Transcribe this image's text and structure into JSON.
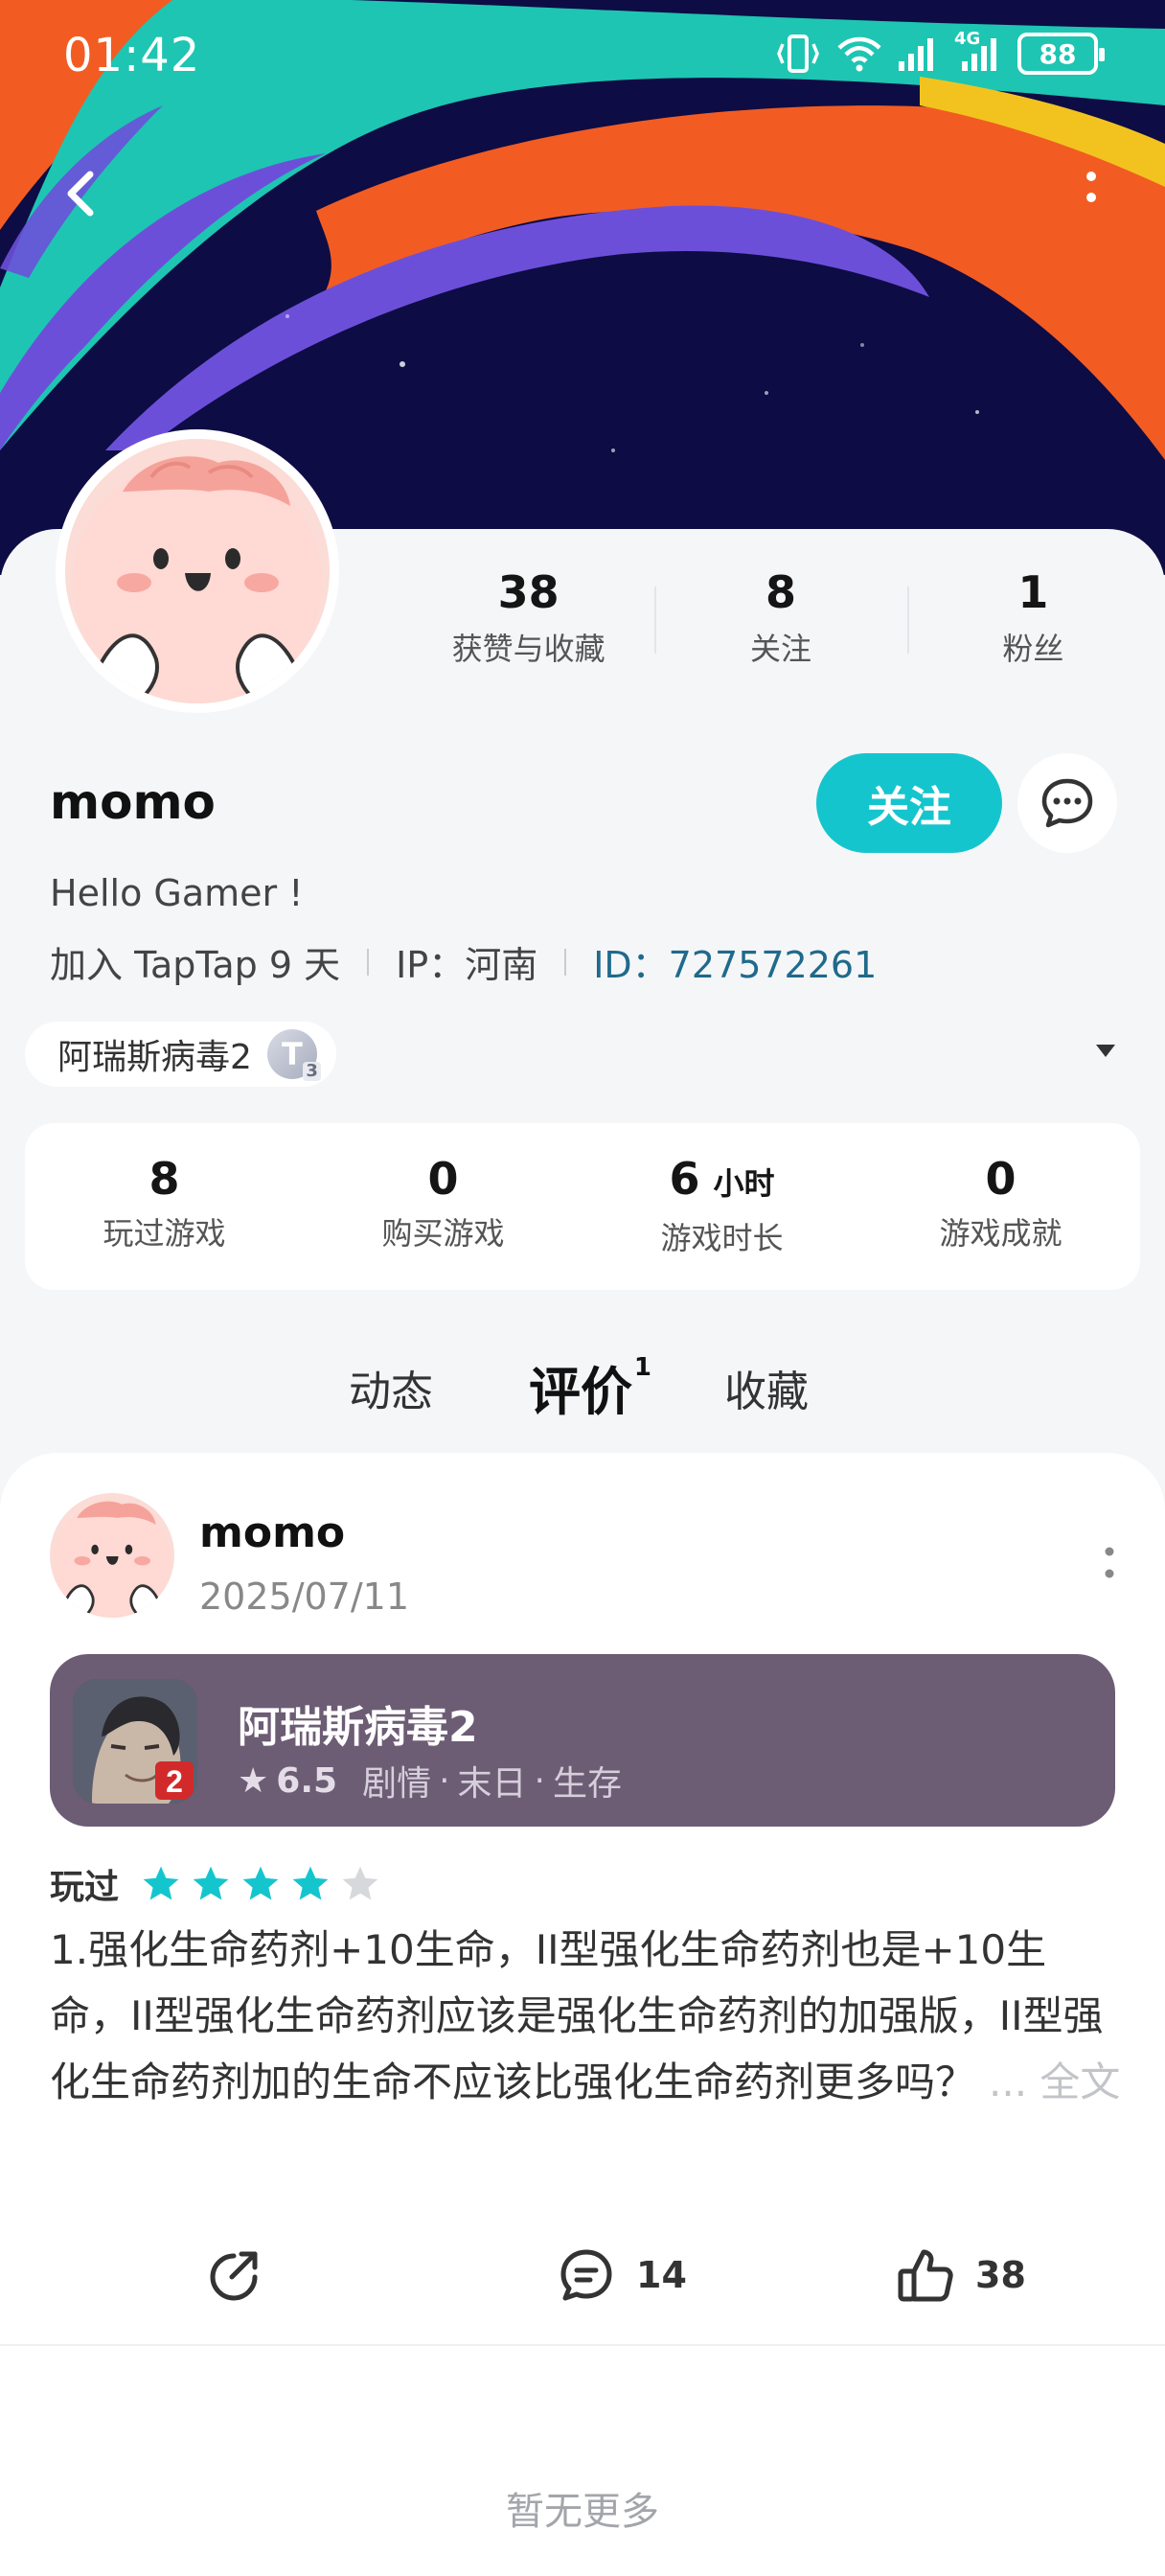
{
  "status_bar": {
    "time": "01:42",
    "network": "4G",
    "battery": "88"
  },
  "profile": {
    "stats": [
      {
        "value": "38",
        "label": "获赞与收藏"
      },
      {
        "value": "8",
        "label": "关注"
      },
      {
        "value": "1",
        "label": "粉丝"
      }
    ],
    "username": "momo",
    "follow_label": "关注",
    "bio": "Hello Gamer !",
    "join": "加入 TapTap 9 天",
    "ip": "IP：河南",
    "id": "ID：727572261",
    "game_chip": {
      "name": "阿瑞斯病毒2",
      "badge": "T",
      "badge_level": "3"
    }
  },
  "game_stats": [
    {
      "value": "8",
      "unit": "",
      "label": "玩过游戏"
    },
    {
      "value": "0",
      "unit": "",
      "label": "购买游戏"
    },
    {
      "value": "6",
      "unit": "小时",
      "label": "游戏时长"
    },
    {
      "value": "0",
      "unit": "",
      "label": "游戏成就"
    }
  ],
  "tabs": [
    {
      "label": "动态",
      "active": false
    },
    {
      "label": "评价",
      "active": true,
      "count": "1"
    },
    {
      "label": "收藏",
      "active": false
    }
  ],
  "review": {
    "user": "momo",
    "date": "2025/07/11",
    "game": {
      "title": "阿瑞斯病毒2",
      "score": "6.5",
      "tags": [
        "剧情",
        "末日",
        "生存"
      ],
      "icon_badge": "2"
    },
    "played_label": "玩过",
    "stars": 4,
    "text": "1.强化生命药剂+10生命，II型强化生命药剂也是+10生命，II型强化生命药剂应该是强化生命药剂的加强版，II型强化生命药剂加的生命不应该比强化生命药剂更多吗？",
    "more_label": "... 全文",
    "comments": "14",
    "likes": "38"
  },
  "footer": {
    "no_more": "暂无更多"
  },
  "colors": {
    "accent": "#15c5ce",
    "banner_bg": "#0d0c44",
    "game_box": "#6c5c74",
    "id_link": "#1f6a8c"
  },
  "icons": [
    "back-icon",
    "more-icon",
    "chat-icon",
    "share-icon",
    "comment-icon",
    "like-icon",
    "star-icon"
  ]
}
